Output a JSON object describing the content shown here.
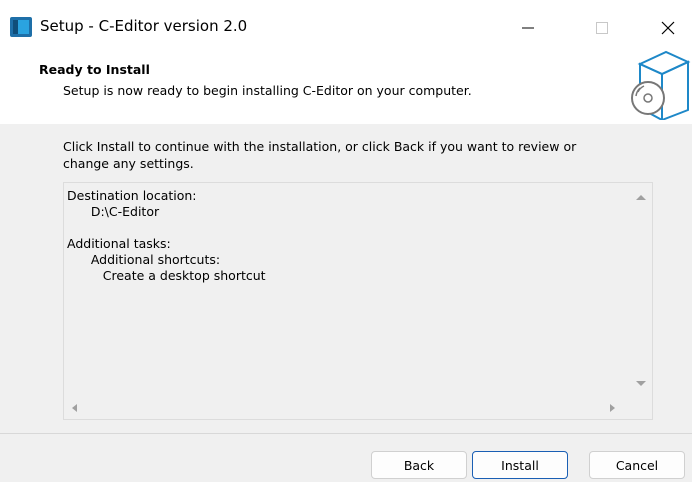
{
  "window": {
    "title": "Setup - C-Editor version 2.0",
    "icons": {
      "app": "setup-app-icon",
      "minimize": "minimize-icon",
      "maximize": "maximize-icon",
      "close": "close-icon"
    }
  },
  "header": {
    "heading": "Ready to Install",
    "subtitle": "Setup is now ready to begin installing C-Editor on your computer.",
    "image_icon": "install-box-disc-icon"
  },
  "body": {
    "instruction": "Click Install to continue with the installation, or click Back if you want to review or change any settings.",
    "memo_lines": [
      "Destination location:",
      "      D:\\C-Editor",
      "",
      "Additional tasks:",
      "      Additional shortcuts:",
      "         Create a desktop shortcut"
    ]
  },
  "buttons": {
    "back": "Back",
    "install": "Install",
    "cancel": "Cancel"
  },
  "colors": {
    "accent": "#1a5fb4",
    "icon_blue": "#1e88c8"
  }
}
